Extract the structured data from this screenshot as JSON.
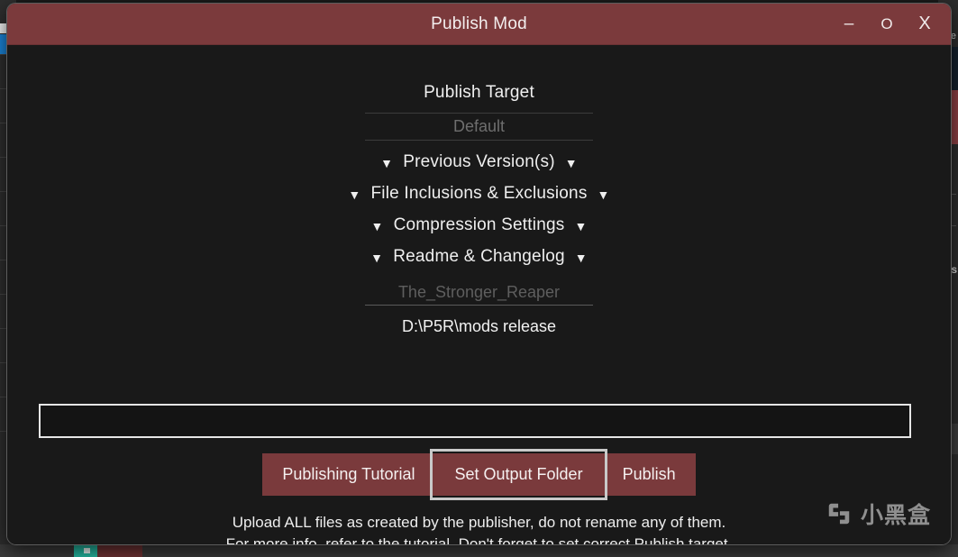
{
  "window": {
    "title": "Publish Mod",
    "controls": {
      "minimize": "–",
      "maximize": "O",
      "close": "X"
    },
    "colors": {
      "titlebar": "#7b3a3c",
      "button": "#7a3a3c",
      "background": "#191919",
      "focus_outline": "#c9c9c9"
    }
  },
  "main": {
    "publish_target_label": "Publish Target",
    "publish_target_value": "Default",
    "sections": [
      {
        "label": "Previous Version(s)",
        "left_arrow": "▼",
        "right_arrow": "▼"
      },
      {
        "label": "File Inclusions & Exclusions",
        "left_arrow": "▼",
        "right_arrow": "▼"
      },
      {
        "label": "Compression Settings",
        "left_arrow": "▼",
        "right_arrow": "▼"
      },
      {
        "label": "Readme & Changelog",
        "left_arrow": "▼",
        "right_arrow": "▼"
      }
    ],
    "mod_name_value": "The_Stronger_Reaper",
    "output_path": "D:\\P5R\\mods release",
    "progress_value": ""
  },
  "buttons": {
    "tutorial": "Publishing Tutorial",
    "set_output_folder": "Set Output Folder",
    "publish": "Publish"
  },
  "footer": {
    "line1": "Upload ALL files as created by the publisher, do not rename any of them.",
    "line2": "For more info, refer to the tutorial. Don't forget to set correct Publish target."
  },
  "watermark": {
    "text": "小黑盒"
  },
  "background": {
    "right_char": "s",
    "right_char2": "e"
  }
}
